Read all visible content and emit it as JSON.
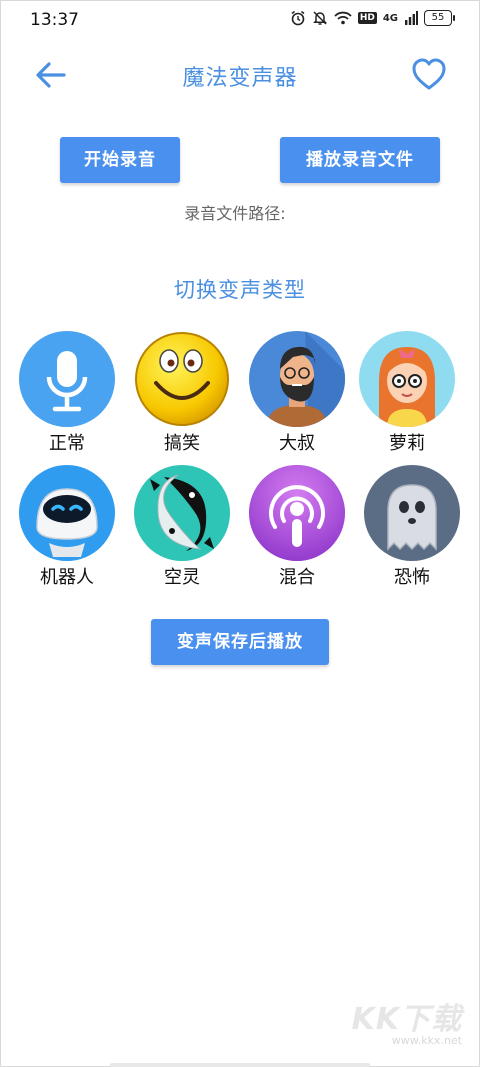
{
  "status_bar": {
    "time": "13:37",
    "network": "4G",
    "hd": "HD",
    "battery": "55"
  },
  "header": {
    "title": "魔法变声器"
  },
  "actions": {
    "record_label": "开始录音",
    "play_label": "播放录音文件"
  },
  "record_path_label": "录音文件路径:",
  "section_title": "切换变声类型",
  "voices": [
    {
      "label": "正常",
      "icon": "microphone-icon",
      "color": "#4aa3f0"
    },
    {
      "label": "搞笑",
      "icon": "laughing-emoji-icon",
      "color": "#f2c400"
    },
    {
      "label": "大叔",
      "icon": "bearded-man-icon",
      "color": "#4a88d8"
    },
    {
      "label": "萝莉",
      "icon": "girl-glasses-icon",
      "color": "#8fdcf0"
    },
    {
      "label": "机器人",
      "icon": "robot-icon",
      "color": "#2f9cf0"
    },
    {
      "label": "空灵",
      "icon": "yin-yang-fish-icon",
      "color": "#2ec4b6"
    },
    {
      "label": "混合",
      "icon": "podcast-icon",
      "color": "#a64bd6"
    },
    {
      "label": "恐怖",
      "icon": "ghost-icon",
      "color": "#5b6d85"
    }
  ],
  "save_play_label": "变声保存后播放",
  "watermark": {
    "brand": "KK下载",
    "url": "www.kkx.net"
  }
}
